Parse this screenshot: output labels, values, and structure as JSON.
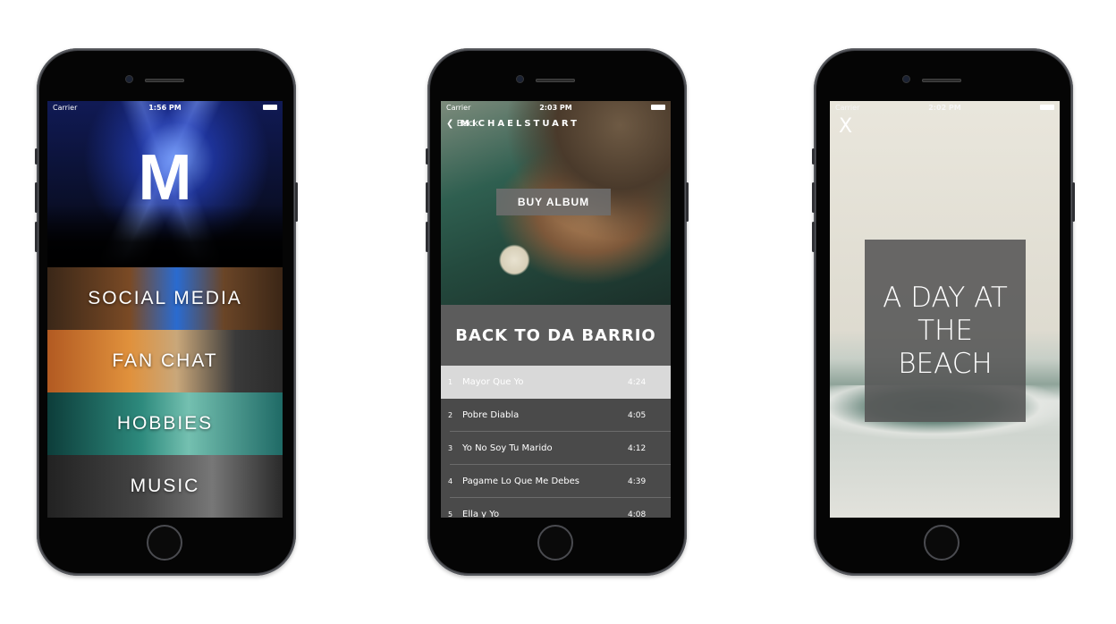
{
  "phone1": {
    "status": {
      "carrier": "Carrier",
      "time": "1:56 PM"
    },
    "logo": "M",
    "menu": [
      "SOCIAL MEDIA",
      "FAN CHAT",
      "HOBBIES",
      "MUSIC"
    ]
  },
  "phone2": {
    "status": {
      "carrier": "Carrier",
      "time": "2:03 PM"
    },
    "back_label": "Back",
    "cover_brand": "MICHAELSTUART",
    "buy_label": "BUY ALBUM",
    "album_title": "BACK TO DA BARRIO",
    "tracks": [
      {
        "num": "1",
        "name": "Mayor Que Yo",
        "duration": "4:24"
      },
      {
        "num": "2",
        "name": "Pobre Diabla",
        "duration": "4:05"
      },
      {
        "num": "3",
        "name": "Yo No Soy Tu Marido",
        "duration": "4:12"
      },
      {
        "num": "4",
        "name": "Pagame Lo Que Me Debes",
        "duration": "4:39"
      },
      {
        "num": "5",
        "name": "Ella y Yo",
        "duration": "4:08"
      }
    ]
  },
  "phone3": {
    "status": {
      "carrier": "Carrier",
      "time": "2:02 PM"
    },
    "close_glyph": "X",
    "title": "A DAY AT THE BEACH"
  }
}
